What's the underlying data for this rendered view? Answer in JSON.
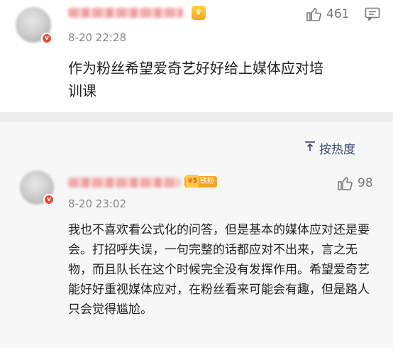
{
  "post": {
    "time": "8-20 22:28",
    "like_count": "461",
    "text": "作为粉丝希望爱奇艺好好给上媒体应对培训课"
  },
  "comments_header": {
    "sort_label": "按热度"
  },
  "comment": {
    "fan_label": "铁粉",
    "fan_level": "5",
    "time": "8-20 23:02",
    "like_count": "98",
    "text": "我也不喜欢看公式化的问答，但是基本的媒体应对还是要会。打招呼失误，一句完整的话都应对不出来，言之无物，而且队长在这个时候完全没有发挥作用。希望爱奇艺能好好重视媒体应对，在粉丝看来可能会有趣，但是路人只会觉得尴尬。"
  },
  "colors": {
    "accent_badge": "#f5a623",
    "sort_link": "#3a4a6a"
  },
  "icons": {
    "like": "thumbs-up-icon",
    "comment": "comment-icon",
    "sort": "sort-icon"
  }
}
